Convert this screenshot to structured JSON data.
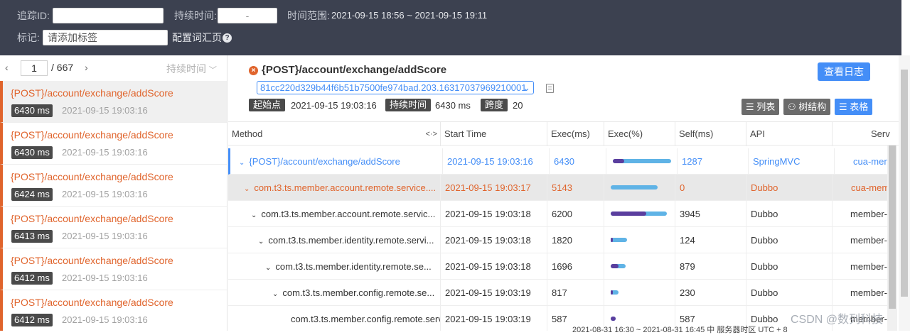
{
  "filter": {
    "trace_id_label": "追踪ID:",
    "trace_id_value": "",
    "duration_label": "持续时间:",
    "duration_value": "-",
    "time_range_label": "时间范围:",
    "time_range_value": "2021-09-15 18:56 ~ 2021-09-15 19:11",
    "tags_label": "标记:",
    "tags_placeholder": "请添加标签",
    "config_link": "配置词汇页",
    "help": "?"
  },
  "pager": {
    "prev": "‹",
    "page": "1",
    "total": "/ 667",
    "next": "›",
    "sort_label": "持续时间",
    "sort_chevron": "﹀"
  },
  "trace_list": [
    {
      "title": "{POST}/account/exchange/addScore",
      "duration": "6430 ms",
      "time": "2021-09-15 19:03:16"
    },
    {
      "title": "{POST}/account/exchange/addScore",
      "duration": "6430 ms",
      "time": "2021-09-15 19:03:16"
    },
    {
      "title": "{POST}/account/exchange/addScore",
      "duration": "6424 ms",
      "time": "2021-09-15 19:03:16"
    },
    {
      "title": "{POST}/account/exchange/addScore",
      "duration": "6413 ms",
      "time": "2021-09-15 19:03:16"
    },
    {
      "title": "{POST}/account/exchange/addScore",
      "duration": "6412 ms",
      "time": "2021-09-15 19:03:16"
    },
    {
      "title": "{POST}/account/exchange/addScore",
      "duration": "6412 ms",
      "time": "2021-09-15 19:03:16"
    }
  ],
  "detail": {
    "error_icon": "×",
    "title": "{POST}/account/exchange/addScore",
    "view_log": "查看日志",
    "trace_id": "81cc220d329b44f6b51b7500fe974bad.203.16317037969210001",
    "start_label": "起始点",
    "start_value": "2021-09-15 19:03:16",
    "duration_label": "持续时间",
    "duration_value": "6430 ms",
    "span_label": "跨度",
    "span_value": "20",
    "views": {
      "list": "☰ 列表",
      "tree": "⚇ 树结构",
      "table": "☰ 表格"
    }
  },
  "table": {
    "columns": [
      "Method",
      "Start Time",
      "Exec(ms)",
      "Exec(%)",
      "Self(ms)",
      "API",
      "Serv"
    ],
    "method_resize": "<·>",
    "rows": [
      {
        "method": "{POST}/account/exchange/addScore",
        "start": "2021-09-15 19:03:16",
        "exec": "6430",
        "exec_pct": 1.0,
        "self_pct": 0.2,
        "self": "1287",
        "api": "SpringMVC",
        "service": "cua-mem"
      },
      {
        "method": "com.t3.ts.member.account.remote.service....",
        "start": "2021-09-15 19:03:17",
        "exec": "5143",
        "exec_pct": 0.8,
        "self_pct": 0.0,
        "self": "0",
        "api": "Dubbo",
        "service": "cua-mem"
      },
      {
        "method": "com.t3.ts.member.account.remote.servic...",
        "start": "2021-09-15 19:03:18",
        "exec": "6200",
        "exec_pct": 0.96,
        "self_pct": 0.61,
        "self": "3945",
        "api": "Dubbo",
        "service": "member-"
      },
      {
        "method": "com.t3.ts.member.identity.remote.servi...",
        "start": "2021-09-15 19:03:18",
        "exec": "1820",
        "exec_pct": 0.28,
        "self_pct": 0.02,
        "self": "124",
        "api": "Dubbo",
        "service": "member-"
      },
      {
        "method": "com.t3.ts.member.identity.remote.se...",
        "start": "2021-09-15 19:03:18",
        "exec": "1696",
        "exec_pct": 0.26,
        "self_pct": 0.14,
        "self": "879",
        "api": "Dubbo",
        "service": "member-"
      },
      {
        "method": "com.t3.ts.member.config.remote.se...",
        "start": "2021-09-15 19:03:19",
        "exec": "817",
        "exec_pct": 0.13,
        "self_pct": 0.04,
        "self": "230",
        "api": "Dubbo",
        "service": "member-"
      },
      {
        "method": "com.t3.ts.member.config.remote.serv...",
        "start": "2021-09-15 19:03:19",
        "exec": "587",
        "exec_pct": 0.09,
        "self_pct": 0.09,
        "self": "587",
        "api": "Dubbo",
        "service": "member-"
      }
    ]
  },
  "bottom_strip": "2021-08-31 16:30 ~ 2021-08-31 16:45    中    服务器时区 UTC + 8",
  "watermark": "CSDN @数列科技",
  "colors": {
    "accent": "#448ef7",
    "error": "#e0642c",
    "header_bg": "#3c4150",
    "bar_total": "#5fb3e6",
    "bar_self": "#5a3e9e"
  }
}
